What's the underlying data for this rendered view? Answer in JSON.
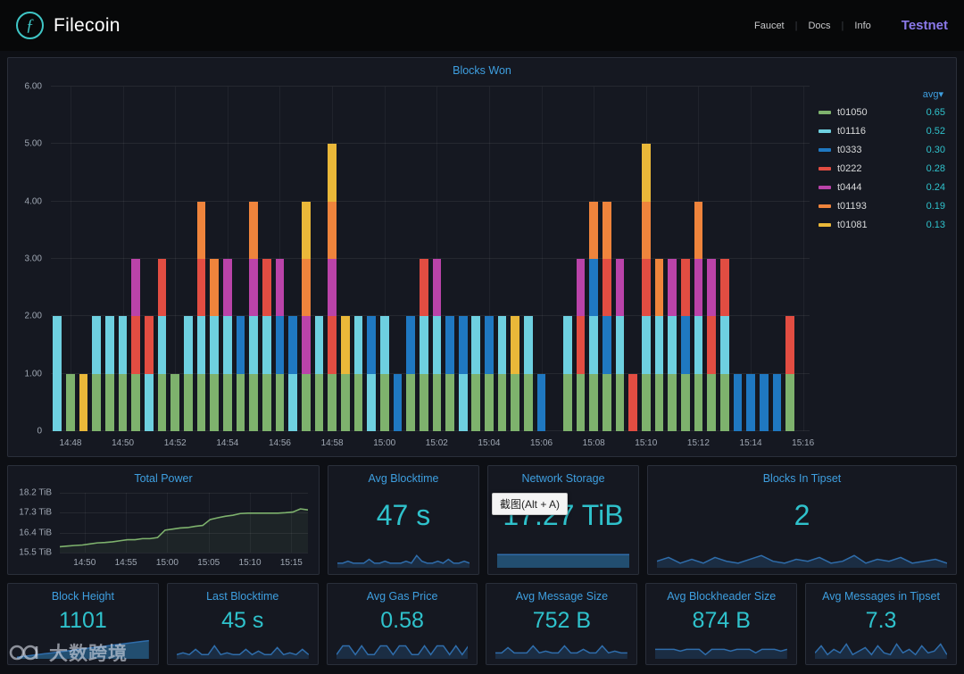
{
  "header": {
    "logo_glyph": "ƒ",
    "brand": "Filecoin",
    "nav": [
      "Faucet",
      "Docs",
      "Info"
    ],
    "network_label": "Testnet"
  },
  "colors": {
    "accent_title": "#3e9fe0",
    "stat_value": "#2fc2cc",
    "testnet_purple": "#8b79ea",
    "spark_line": "#2f6dab",
    "spark_fill": "rgba(47,109,171,0.25)",
    "spark_fill_solid": "rgba(36,88,126,0.85)",
    "axis_label": "#9fa7b3"
  },
  "chart_data": {
    "blocks_won": {
      "type": "bar",
      "stacked": true,
      "title": "Blocks Won",
      "legend_header": "avg▾",
      "interval": "30s",
      "time_range": [
        "14:47:30",
        "15:16:00"
      ],
      "slot_count": 58,
      "tick_start_index": 1,
      "tick_step": 4,
      "x_ticks": [
        "14:48",
        "14:50",
        "14:52",
        "14:54",
        "14:56",
        "14:58",
        "15:00",
        "15:02",
        "15:04",
        "15:06",
        "15:08",
        "15:10",
        "15:12",
        "15:14",
        "15:16"
      ],
      "ylim": [
        0,
        6
      ],
      "y_ticks": [
        "6.00",
        "5.00",
        "4.00",
        "3.00",
        "2.00",
        "1.00",
        "0"
      ],
      "series": [
        {
          "name": "t01050",
          "avg": "0.65",
          "color": "#7EB26D",
          "values": [
            0,
            1,
            0,
            1,
            1,
            1,
            1,
            0,
            1,
            1,
            1,
            1,
            1,
            1,
            1,
            1,
            1,
            1,
            0,
            1,
            1,
            1,
            1,
            1,
            0,
            1,
            0,
            1,
            1,
            1,
            1,
            0,
            1,
            1,
            1,
            1,
            1,
            0,
            0,
            1,
            1,
            1,
            1,
            1,
            0,
            1,
            1,
            1,
            1,
            1,
            1,
            1,
            0,
            0,
            0,
            0,
            1,
            0
          ]
        },
        {
          "name": "t01116",
          "avg": "0.52",
          "color": "#6ED0E0",
          "values": [
            2,
            0,
            0,
            1,
            1,
            1,
            0,
            1,
            1,
            0,
            1,
            1,
            1,
            1,
            0,
            1,
            1,
            0,
            1,
            0,
            1,
            0,
            0,
            1,
            1,
            1,
            0,
            0,
            1,
            1,
            0,
            1,
            1,
            0,
            1,
            0,
            1,
            0,
            0,
            1,
            0,
            1,
            0,
            1,
            0,
            1,
            1,
            1,
            0,
            1,
            0,
            1,
            0,
            0,
            0,
            0,
            0,
            0
          ]
        },
        {
          "name": "t0333",
          "avg": "0.30",
          "color": "#1F78C1",
          "values": [
            0,
            0,
            0,
            0,
            0,
            0,
            0,
            0,
            0,
            0,
            0,
            0,
            0,
            0,
            1,
            0,
            0,
            1,
            1,
            0,
            0,
            0,
            0,
            0,
            1,
            0,
            1,
            1,
            0,
            0,
            1,
            1,
            0,
            1,
            0,
            0,
            0,
            1,
            0,
            0,
            0,
            1,
            1,
            0,
            0,
            0,
            0,
            0,
            1,
            0,
            0,
            0,
            1,
            1,
            1,
            1,
            0,
            0
          ]
        },
        {
          "name": "t0222",
          "avg": "0.28",
          "color": "#E24D42",
          "values": [
            0,
            0,
            0,
            0,
            0,
            0,
            1,
            1,
            1,
            0,
            0,
            1,
            0,
            0,
            0,
            0,
            1,
            0,
            0,
            0,
            0,
            1,
            0,
            0,
            0,
            0,
            0,
            0,
            1,
            0,
            0,
            0,
            0,
            0,
            0,
            0,
            0,
            0,
            0,
            0,
            1,
            0,
            1,
            0,
            1,
            1,
            0,
            0,
            1,
            0,
            1,
            1,
            0,
            0,
            0,
            0,
            1,
            0
          ]
        },
        {
          "name": "t0444",
          "avg": "0.24",
          "color": "#BA43A9",
          "values": [
            0,
            0,
            0,
            0,
            0,
            0,
            1,
            0,
            0,
            0,
            0,
            0,
            0,
            1,
            0,
            1,
            0,
            1,
            0,
            1,
            0,
            1,
            0,
            0,
            0,
            0,
            0,
            0,
            0,
            1,
            0,
            0,
            0,
            0,
            0,
            0,
            0,
            0,
            0,
            0,
            1,
            0,
            0,
            1,
            0,
            0,
            0,
            1,
            0,
            1,
            1,
            0,
            0,
            0,
            0,
            0,
            0,
            0
          ]
        },
        {
          "name": "t01193",
          "avg": "0.19",
          "color": "#EF843C",
          "values": [
            0,
            0,
            0,
            0,
            0,
            0,
            0,
            0,
            0,
            0,
            0,
            1,
            1,
            0,
            0,
            1,
            0,
            0,
            0,
            1,
            0,
            1,
            0,
            0,
            0,
            0,
            0,
            0,
            0,
            0,
            0,
            0,
            0,
            0,
            0,
            0,
            0,
            0,
            0,
            0,
            0,
            1,
            1,
            0,
            0,
            1,
            1,
            0,
            0,
            1,
            0,
            0,
            0,
            0,
            0,
            0,
            0,
            0
          ]
        },
        {
          "name": "t01081",
          "avg": "0.13",
          "color": "#EAB839",
          "values": [
            0,
            0,
            1,
            0,
            0,
            0,
            0,
            0,
            0,
            0,
            0,
            0,
            0,
            0,
            0,
            0,
            0,
            0,
            0,
            1,
            0,
            1,
            1,
            0,
            0,
            0,
            0,
            0,
            0,
            0,
            0,
            0,
            0,
            0,
            0,
            1,
            0,
            0,
            0,
            0,
            0,
            0,
            0,
            0,
            0,
            1,
            0,
            0,
            0,
            0,
            0,
            0,
            0,
            0,
            0,
            0,
            0,
            0
          ]
        }
      ]
    },
    "total_power": {
      "type": "line",
      "title": "Total Power",
      "color": "#7EB26D",
      "ylim": [
        15.5,
        18.2
      ],
      "y_ticks": [
        "18.2 TiB",
        "17.3 TiB",
        "16.4 TiB",
        "15.5 TiB"
      ],
      "x_ticks": [
        "14:50",
        "14:55",
        "15:00",
        "15:05",
        "15:10",
        "15:15"
      ],
      "values": [
        15.72,
        15.75,
        15.78,
        15.8,
        15.85,
        15.9,
        15.92,
        15.95,
        16.0,
        16.05,
        16.05,
        16.1,
        16.1,
        16.15,
        16.5,
        16.55,
        16.6,
        16.62,
        16.68,
        16.72,
        17.0,
        17.08,
        17.15,
        17.2,
        17.28,
        17.3,
        17.3,
        17.3,
        17.3,
        17.3,
        17.32,
        17.35,
        17.5,
        17.45
      ]
    },
    "stats": [
      {
        "title": "Avg Blocktime",
        "value": "47 s",
        "style": "area",
        "spark": [
          2,
          2,
          3,
          2,
          2,
          2,
          4,
          2,
          2,
          3,
          2,
          2,
          2,
          3,
          2,
          6,
          3,
          2,
          2,
          3,
          2,
          4,
          2,
          2,
          3,
          2
        ]
      },
      {
        "title": "Network Storage",
        "value": "17.27 TiB",
        "style": "solid",
        "spark": [
          6.5,
          6.5,
          6.5,
          6.5,
          6.5,
          6.5,
          6.5,
          6.5,
          6.5,
          6.5,
          6.5,
          6.5,
          6.5,
          6.5,
          6.5,
          6.5,
          6.5,
          6.5,
          6.5,
          6.5
        ]
      },
      {
        "title": "Blocks In Tipset",
        "value": "2",
        "style": "area",
        "spark": [
          3,
          5,
          2,
          4,
          2,
          5,
          3,
          2,
          4,
          6,
          3,
          2,
          4,
          3,
          5,
          2,
          3,
          6,
          2,
          4,
          3,
          5,
          2,
          3,
          4,
          2
        ]
      },
      {
        "title": "Block Height",
        "value": "1101",
        "style": "solid",
        "spark": [
          0.5,
          1,
          1.5,
          2,
          2.5,
          3,
          3.5,
          4,
          4.5,
          5,
          5.5,
          6,
          6.5,
          7,
          7.5,
          8,
          8.5,
          9,
          9.5,
          10
        ]
      },
      {
        "title": "Last Blocktime",
        "value": "45 s",
        "style": "area",
        "spark": [
          2,
          3,
          2,
          5,
          2,
          2,
          7,
          2,
          3,
          2,
          2,
          5,
          2,
          4,
          2,
          2,
          6,
          2,
          3,
          2,
          5,
          2
        ]
      },
      {
        "title": "Avg Gas Price",
        "value": "0.58",
        "style": "area",
        "spark": [
          2,
          7,
          7,
          2,
          7,
          2,
          2,
          7,
          7,
          2,
          7,
          7,
          2,
          2,
          7,
          2,
          7,
          7,
          2,
          7,
          2,
          7
        ]
      },
      {
        "title": "Avg Message Size",
        "value": "752 B",
        "style": "area",
        "spark": [
          3,
          3,
          6,
          3,
          3,
          3,
          7,
          3,
          4,
          3,
          3,
          7,
          3,
          3,
          5,
          3,
          3,
          7,
          3,
          4,
          3,
          3
        ]
      },
      {
        "title": "Avg Blockheader Size",
        "value": "874 B",
        "style": "area",
        "spark": [
          5,
          5,
          5,
          5,
          4,
          5,
          5,
          5,
          2,
          5,
          5,
          5,
          4,
          5,
          5,
          5,
          3,
          5,
          5,
          5,
          4,
          5
        ]
      },
      {
        "title": "Avg Messages in Tipset",
        "value": "7.3",
        "style": "area",
        "spark": [
          3,
          7,
          2,
          5,
          3,
          8,
          2,
          4,
          6,
          2,
          7,
          3,
          2,
          8,
          3,
          5,
          2,
          7,
          3,
          4,
          8,
          2
        ]
      }
    ]
  },
  "overlays": {
    "screenshot_tooltip": "截图(Alt + A)",
    "watermark_text": "大数跨境"
  }
}
